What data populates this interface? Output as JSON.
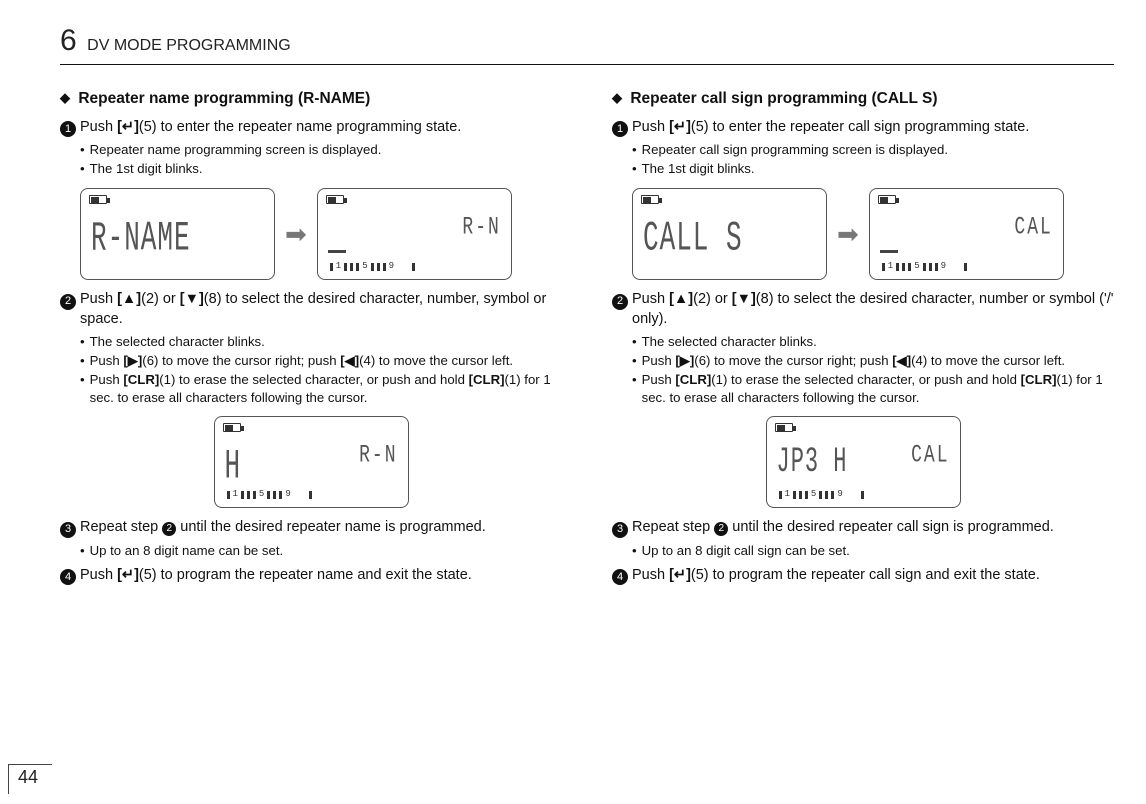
{
  "header": {
    "chapter_number": "6",
    "chapter_title": "DV MODE PROGRAMMING"
  },
  "page_number": "44",
  "left": {
    "title": "Repeater name programming (R-NAME)",
    "step1": {
      "num": "1",
      "text_a": "Push ",
      "key1": "[↵]",
      "text_b": "(5) to enter the repeater name programming state."
    },
    "step1_bullets": [
      "Repeater name programming screen is displayed.",
      "The 1st digit blinks."
    ],
    "lcd1_big": "R-NAME",
    "lcd2_small": "R-N",
    "step2": {
      "num": "2",
      "text_a": "Push ",
      "key1": "[▲]",
      "text_b": "(2) or ",
      "key2": "[▼]",
      "text_c": "(8) to select the desired character, number, symbol or space."
    },
    "step2_bullets_a": "The selected character blinks.",
    "step2_bullets_b_pre": "Push ",
    "step2_bullets_b_k1": "[▶]",
    "step2_bullets_b_mid": "(6) to move the cursor right; push ",
    "step2_bullets_b_k2": "[◀]",
    "step2_bullets_b_post": "(4) to move the cursor left.",
    "step2_bullets_c_pre": "Push ",
    "step2_bullets_c_k1": "[CLR]",
    "step2_bullets_c_mid": "(1) to erase the selected character, or push and hold ",
    "step2_bullets_c_k2": "[CLR]",
    "step2_bullets_c_post": "(1) for 1 sec. to erase all characters following the cursor.",
    "lcd3_left": "H",
    "lcd3_right": "R-N",
    "step3": {
      "num": "3",
      "text_a": "Repeat step ",
      "ref": "2",
      "text_b": " until the desired repeater name is programmed."
    },
    "step3_bullet": "Up to an 8 digit name can be set.",
    "step4": {
      "num": "4",
      "text_a": "Push ",
      "key1": "[↵]",
      "text_b": "(5) to program the repeater name and exit the state."
    }
  },
  "right": {
    "title": "Repeater call sign programming (CALL S)",
    "step1": {
      "num": "1",
      "text_a": "Push ",
      "key1": "[↵]",
      "text_b": "(5) to enter the repeater call sign programming state."
    },
    "step1_bullets": [
      "Repeater call sign programming screen is displayed.",
      "The 1st digit blinks."
    ],
    "lcd1_big": "CALL S",
    "lcd2_small": "CAL",
    "step2": {
      "num": "2",
      "text_a": "Push ",
      "key1": "[▲]",
      "text_b": "(2) or ",
      "key2": "[▼]",
      "text_c": "(8) to select the desired character, number or symbol ('/' only)."
    },
    "step2_bullets_a": "The selected character blinks.",
    "step2_bullets_b_pre": "Push ",
    "step2_bullets_b_k1": "[▶]",
    "step2_bullets_b_mid": "(6) to move the cursor right; push ",
    "step2_bullets_b_k2": "[◀]",
    "step2_bullets_b_post": "(4) to move the cursor left.",
    "step2_bullets_c_pre": "Push ",
    "step2_bullets_c_k1": "[CLR]",
    "step2_bullets_c_mid": "(1) to erase the selected character, or push and hold ",
    "step2_bullets_c_k2": "[CLR]",
    "step2_bullets_c_post": "(1) for 1 sec. to erase all characters following the cursor.",
    "lcd3_left": "JP3 H",
    "lcd3_right": "CAL",
    "step3": {
      "num": "3",
      "text_a": "Repeat step ",
      "ref": "2",
      "text_b": " until the desired repeater call sign is programmed."
    },
    "step3_bullet": "Up to an 8 digit call sign can be set.",
    "step4": {
      "num": "4",
      "text_a": "Push ",
      "key1": "[↵]",
      "text_b": "(5) to program the repeater call sign and exit the state."
    }
  }
}
